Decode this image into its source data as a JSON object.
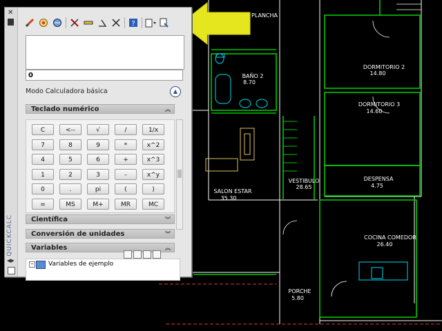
{
  "quickcalc": {
    "strip_title": "QUICKCALC",
    "input_value": "0",
    "mode_label": "Modo Calculadora básica",
    "sections": {
      "numeric": "Teclado numérico",
      "scientific": "Científica",
      "units": "Conversión de unidades",
      "variables": "Variables"
    },
    "keys": [
      [
        "C",
        "<--",
        "√",
        "/",
        "1/x"
      ],
      [
        "7",
        "8",
        "9",
        "*",
        "x^2"
      ],
      [
        "4",
        "5",
        "6",
        "+",
        "x^3"
      ],
      [
        "1",
        "2",
        "3",
        "-",
        "x^y"
      ],
      [
        "0",
        ".",
        "pi",
        "(",
        ")"
      ],
      [
        "=",
        "MS",
        "M+",
        "MR",
        "MC"
      ]
    ],
    "variables_item": "Variables de ejemplo",
    "toolbar_icons": [
      "clear-icon",
      "history-icon",
      "get-coordinates-icon",
      "distance-icon",
      "line-intersection-icon",
      "angle-icon",
      "intersect-icon",
      "help-icon",
      "paste-icon",
      "paste-to-commandline-icon"
    ]
  },
  "plan": {
    "rooms": [
      {
        "name": "PLANCHA",
        "area": "",
        "key": "plancha"
      },
      {
        "name": "DORMITORIO 2",
        "area": "14.80",
        "key": "d2"
      },
      {
        "name": "BAÑO 2",
        "area": "8.70",
        "key": "bano"
      },
      {
        "name": "DORMITORIO 3",
        "area": "14.60",
        "key": "d3"
      },
      {
        "name": "VESTIBULO",
        "area": "28.65",
        "key": "vest"
      },
      {
        "name": "DESPENSA",
        "area": "4.75",
        "key": "desp"
      },
      {
        "name": "SALON ESTAR",
        "area": "35.30",
        "key": "salon"
      },
      {
        "name": "COCINA COMEDOR",
        "area": "26.40",
        "key": "cocina"
      },
      {
        "name": "PORCHE",
        "area": "5.80",
        "key": "porche"
      }
    ]
  },
  "colors": {
    "wall": "#00c800",
    "outline": "#ffffff",
    "cyan": "#00b4c8",
    "arrow": "#e6e61e",
    "dim": "#dc3c3c"
  }
}
